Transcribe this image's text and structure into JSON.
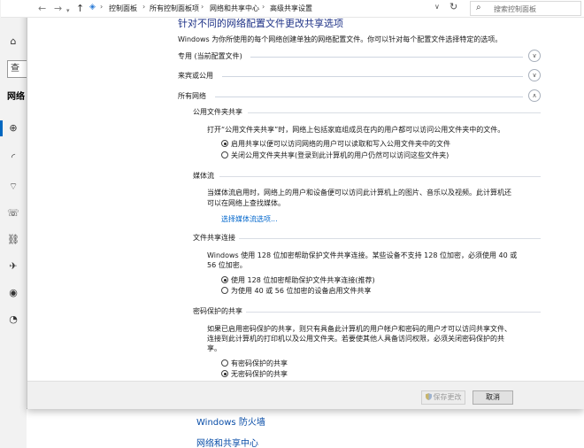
{
  "address_bar": {
    "crumbs": [
      "控制面板",
      "所有控制面板项",
      "网络和共享中心",
      "高级共享设置"
    ],
    "search_placeholder": "搜索控制面板"
  },
  "background_window": {
    "search_partial": "查",
    "section_partial": "网络",
    "links": [
      "Windows 防火墙",
      "网络和共享中心"
    ]
  },
  "page": {
    "heading": "针对不同的网络配置文件更改共享选项",
    "intro": "Windows 为你所使用的每个网络创建单独的网络配置文件。你可以针对每个配置文件选择特定的选项。",
    "profiles": [
      {
        "label": "专用 (当前配置文件)",
        "state": "collapsed"
      },
      {
        "label": "来宾或公用",
        "state": "collapsed"
      },
      {
        "label": "所有网络",
        "state": "expanded"
      }
    ],
    "public_folder": {
      "title": "公用文件夹共享",
      "description": "打开“公用文件夹共享”时，网络上包括家庭组成员在内的用户都可以访问公用文件夹中的文件。",
      "options": [
        {
          "label": "启用共享以便可以访问网络的用户可以读取和写入公用文件夹中的文件",
          "selected": true
        },
        {
          "label": "关闭公用文件夹共享(登录到此计算机的用户仍然可以访问这些文件夹)",
          "selected": false
        }
      ]
    },
    "media": {
      "title": "媒体流",
      "description_1": "当媒体流启用时，网络上的用户和设备便可以访问此计算机上的图片、音乐以及视频。此计算机还",
      "description_2": "可以在网络上查找媒体。",
      "link": "选择媒体流选项..."
    },
    "file_sharing": {
      "title": "文件共享连接",
      "description_1": "Windows 使用 128 位加密帮助保护文件共享连接。某些设备不支持 128 位加密，必须使用 40 或",
      "description_2": "56 位加密。",
      "options": [
        {
          "label": "使用 128 位加密帮助保护文件共享连接(推荐)",
          "selected": true
        },
        {
          "label": "为使用 40 或 56 位加密的设备启用文件共享",
          "selected": false
        }
      ]
    },
    "password": {
      "title": "密码保护的共享",
      "description_1": "如果已启用密码保护的共享，则只有具备此计算机的用户帐户和密码的用户才可以访问共享文件、",
      "description_2": "连接到此计算机的打印机以及公用文件夹。若要使其他人具备访问权限，必须关闭密码保护的共",
      "description_3": "享。",
      "options": [
        {
          "label": "有密码保护的共享",
          "selected": false
        },
        {
          "label": "无密码保护的共享",
          "selected": true
        }
      ]
    }
  },
  "footer": {
    "save_label": "保存更改",
    "cancel_label": "取消"
  }
}
